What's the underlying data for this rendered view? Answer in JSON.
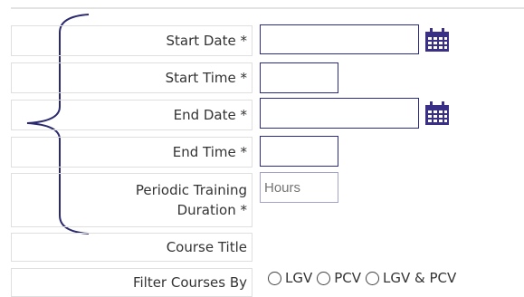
{
  "form": {
    "start_date_label": "Start Date *",
    "start_time_label": "Start Time *",
    "end_date_label": "End Date *",
    "end_time_label": "End Time *",
    "periodic_training_label_line1": "Periodic Training",
    "periodic_training_label_line2": "Duration *",
    "course_title_label": "Course Title",
    "filter_courses_label": "Filter Courses By",
    "start_date_value": "",
    "start_time_value": "",
    "end_date_value": "",
    "end_time_value": "",
    "hours_placeholder": "Hours",
    "filter_options": [
      "LGV",
      "PCV",
      "LGV & PCV"
    ]
  },
  "icons": {
    "calendar": "calendar-icon",
    "brace": "curly-brace-annotation"
  },
  "colors": {
    "field_border": "#2b2a87",
    "calendar": "#3a2f86"
  }
}
